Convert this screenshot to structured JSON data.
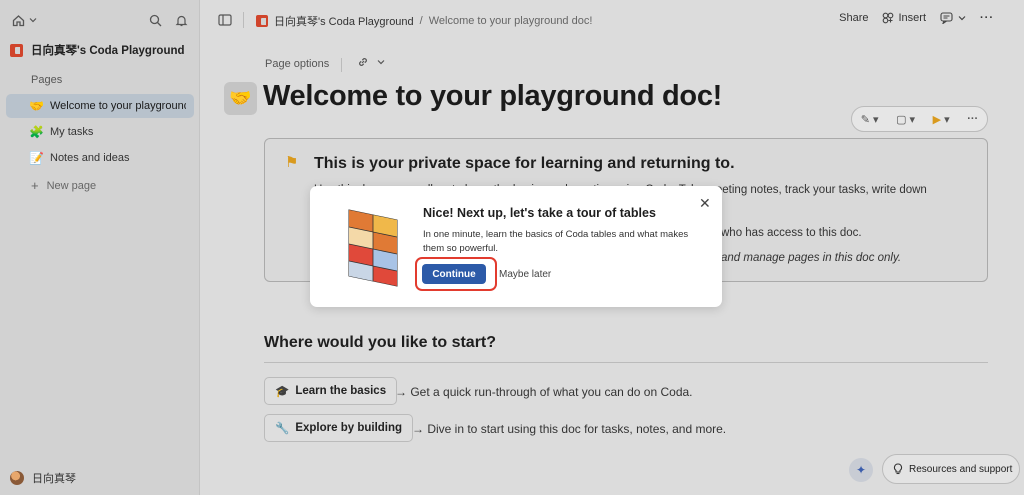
{
  "sidebar": {
    "doc_title": "日向真琴's Coda Playground",
    "pages_label": "Pages",
    "pages": [
      {
        "icon": "handshake-icon",
        "glyph": "🤝",
        "label": "Welcome to your playground doc!",
        "active": true
      },
      {
        "icon": "tasks-icon",
        "glyph": "🧩",
        "label": "My tasks",
        "active": false
      },
      {
        "icon": "notes-icon",
        "glyph": "📝",
        "label": "Notes and ideas",
        "active": false
      }
    ],
    "new_page_label": "New page",
    "user_name": "日向真琴"
  },
  "topbar": {
    "doc_name": "日向真琴's Coda Playground",
    "separator": "/",
    "page_name": "Welcome to your playground doc!",
    "share_label": "Share",
    "insert_label": "Insert"
  },
  "main": {
    "page_options_label": "Page options",
    "page_title": "Welcome to your playground doc!",
    "callout": {
      "heading": "This is your private space for learning and returning to.",
      "line1": "Use this doc as a sandbox to learn the basics and practice using Coda. Take meeting notes, track your tasks, write down",
      "line2": "who has access to this doc.",
      "line3": "and manage pages in this doc only."
    },
    "section_title": "Where would you like to start?",
    "options": [
      {
        "icon": "graduation-cap-icon",
        "label": "Learn the basics",
        "desc": "→ Get a quick run-through of what you can do on Coda."
      },
      {
        "icon": "wrench-icon",
        "label": "Explore by building",
        "desc": "→ Dive in to start using this doc for tasks, notes, and more."
      }
    ],
    "resources_label": "Resources and support"
  },
  "modal": {
    "title": "Nice! Next up, let's take a tour of tables",
    "body": "In one minute, learn the basics of Coda tables and what makes them so powerful.",
    "continue_label": "Continue",
    "maybe_later_label": "Maybe later",
    "highlight_color": "#e23b2e"
  },
  "colors": {
    "accent": "#2c5aa8",
    "brand": "#d0442b"
  }
}
